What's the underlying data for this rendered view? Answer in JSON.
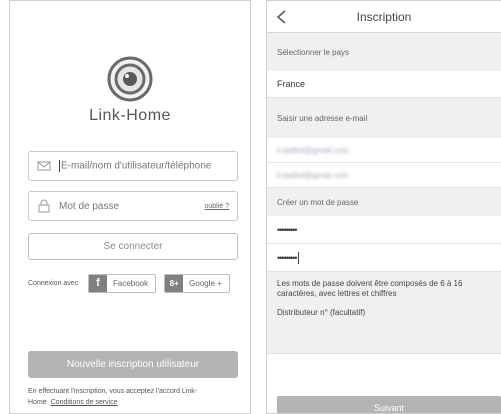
{
  "login": {
    "brand": "Link-Home",
    "email_placeholder": "E-mail/nom d'utilisateur/téléphone",
    "password_placeholder": "Mot de passe",
    "forgot_label": "oublié ?",
    "login_button": "Se connecter",
    "connect_with": "Connexion avec",
    "facebook_label": "Facebook",
    "facebook_badge": "f",
    "google_label": "Google +",
    "google_badge": "8+",
    "register_button": "Nouvelle inscription utilisateur",
    "terms_text": "En effectuant l'inscription, vous acceptez l'accord Link-Home",
    "terms_link": "Conditions de service"
  },
  "register": {
    "title": "Inscription",
    "country_label": "Sélectionner le pays",
    "country_value": "France",
    "email_label": "Saisir une adresse e-mail",
    "email_value": "k.baillot@gmail.com",
    "email_confirm_value": "k.baillot@gmail.com",
    "password_label": "Créer un mot de passe",
    "password_value": "•••••••••",
    "password_confirm_value": "•••••••••",
    "password_hint": "Les mots de passe doivent être composés de 6 à 16 caractères, avec lettres et chiffres",
    "distributor_label": "Distributeur n° (facultatif)",
    "submit_button": "Suivant"
  },
  "icons": {
    "logo": "camera-lens-icon",
    "email": "envelope-icon",
    "password": "lock-icon",
    "back": "chevron-left-icon"
  }
}
